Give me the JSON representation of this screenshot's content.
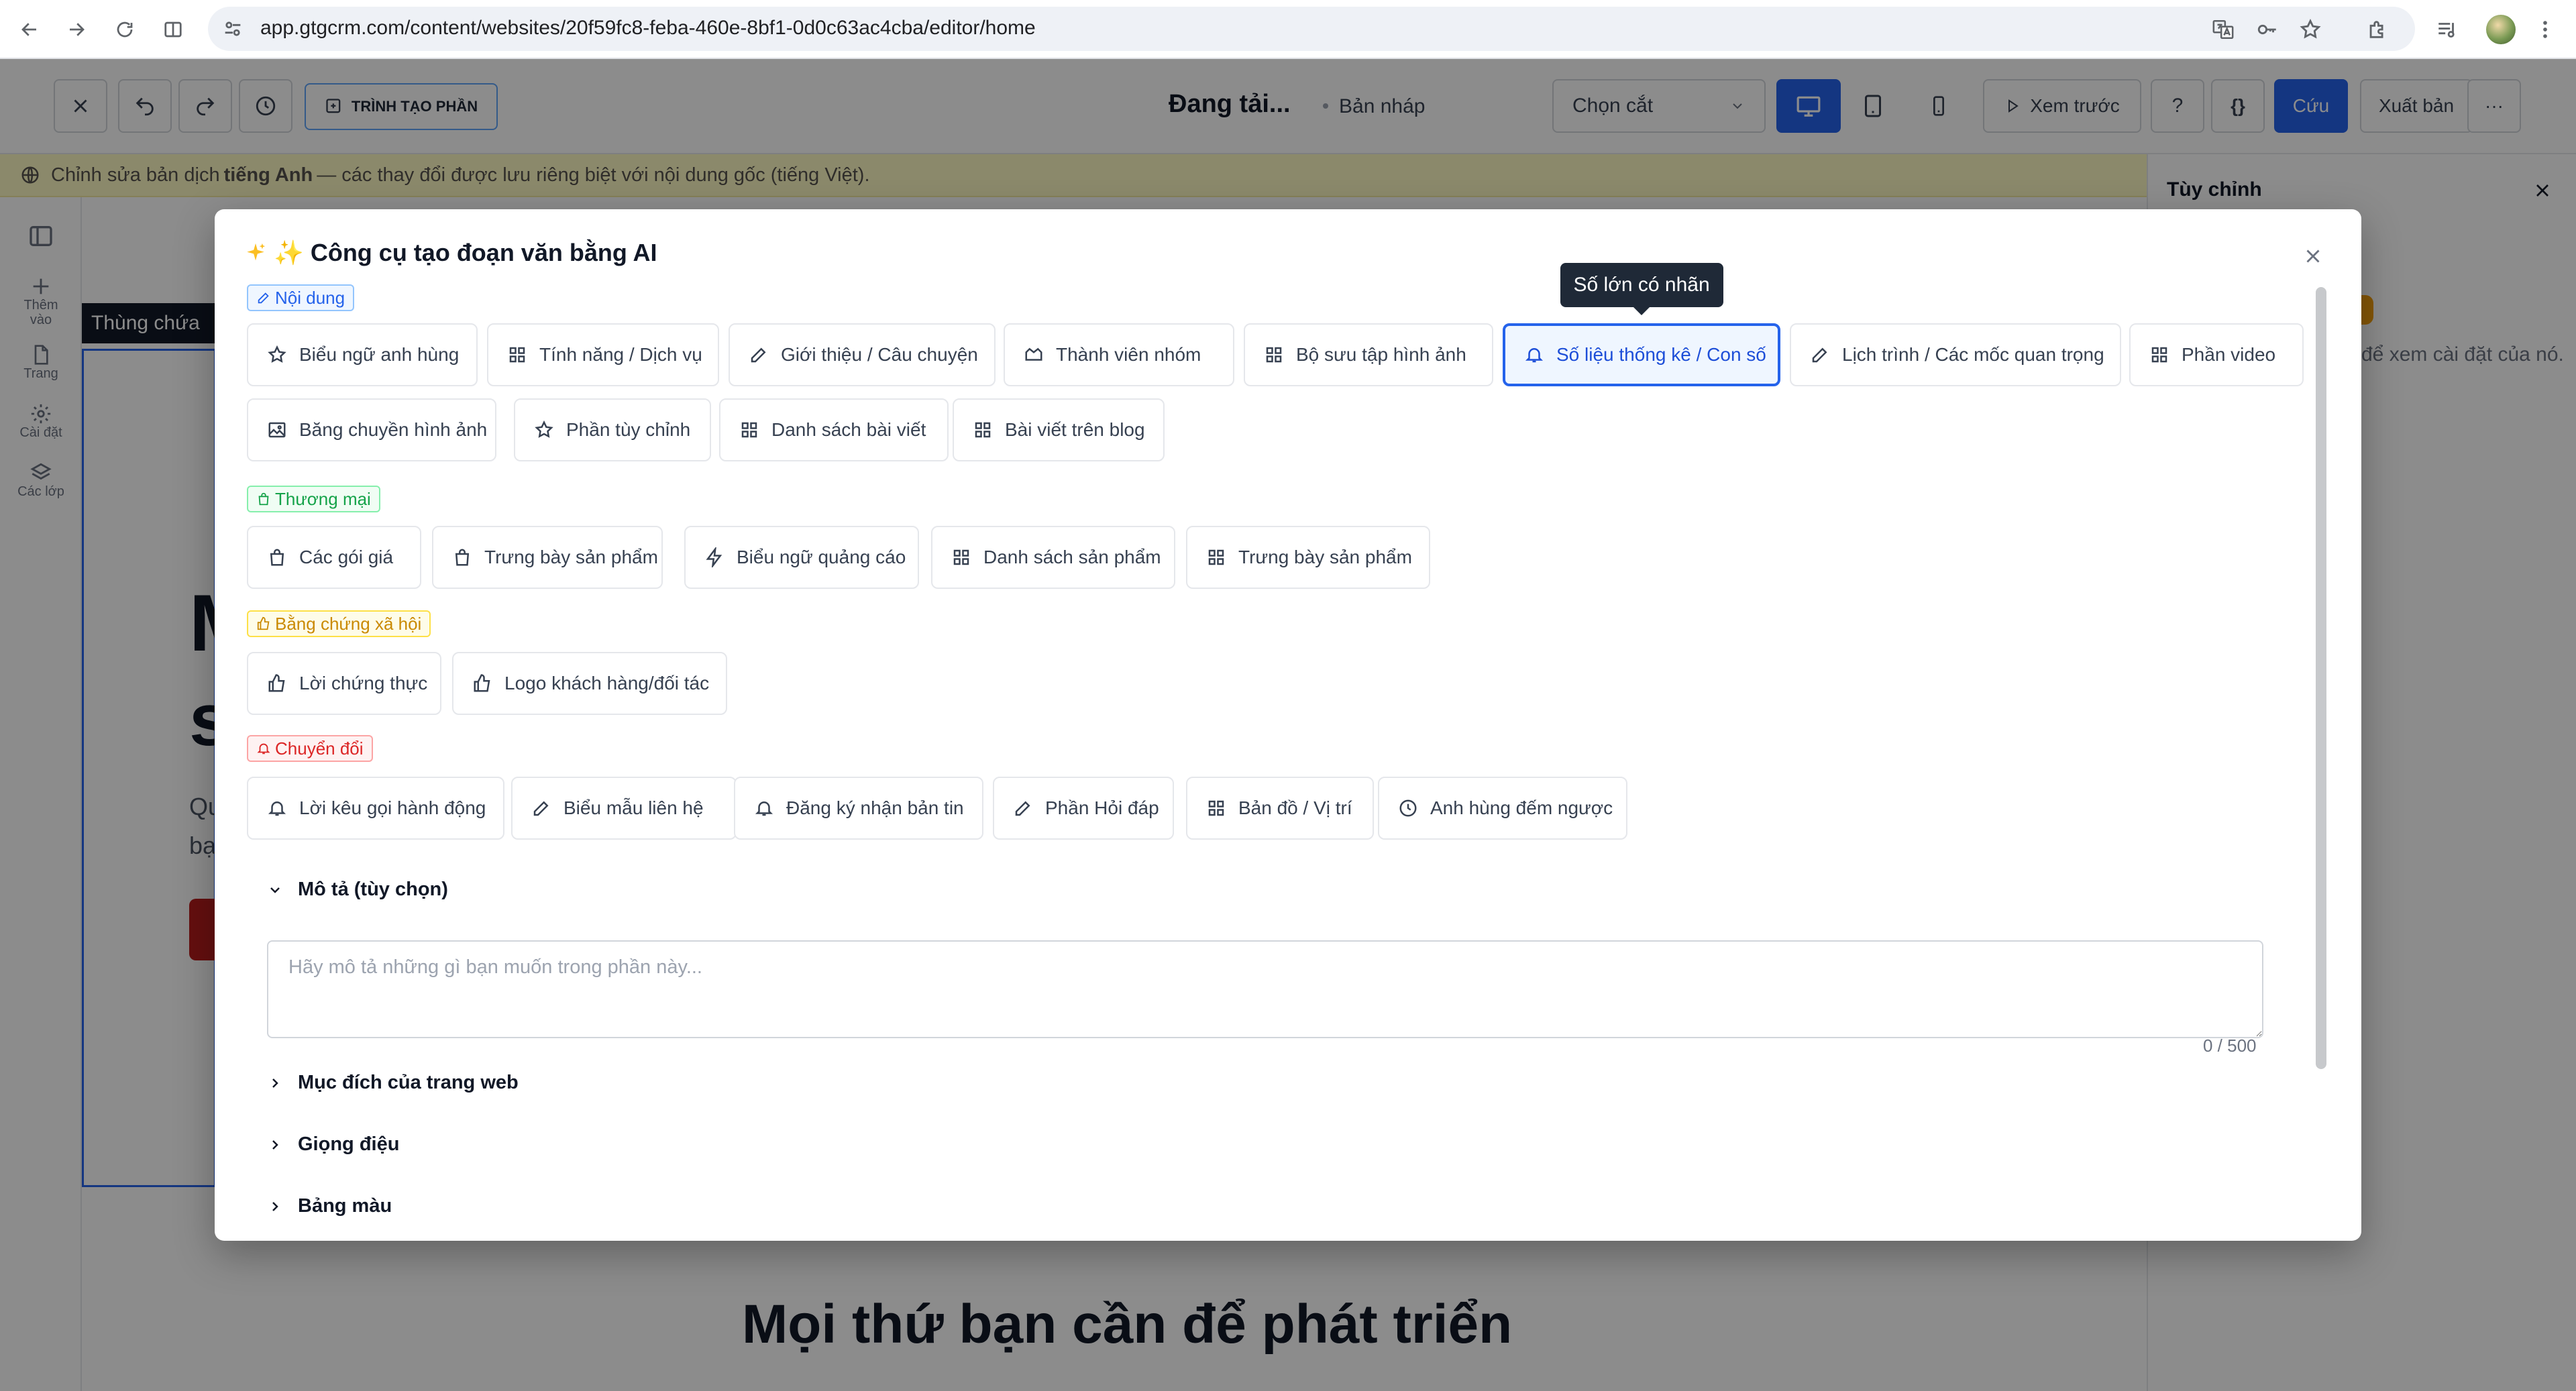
{
  "browser": {
    "url": "app.gtgcrm.com/content/websites/20f59fc8-feba-460e-8bf1-0d0c63ac4cba/editor/home"
  },
  "editor": {
    "creator_label": "TRÌNH TẠO PHẦN",
    "page_status": "Đang tải...",
    "draft_label": "Bản nháp",
    "breakpoint_select": "Chọn cắt",
    "preview_label": "Xem trước",
    "help_label": "?",
    "code_label": "{}",
    "save_label": "Cứu",
    "publish_label": "Xuất bản",
    "more_label": "···",
    "translation_banner_prefix": "Chỉnh sửa bản dịch ",
    "translation_banner_lang": "tiếng Anh",
    "translation_banner_suffix": " — các thay đổi được lưu riêng biệt với nội dung gốc (tiếng Việt).",
    "rail": [
      {
        "label": "Thêm vào"
      },
      {
        "label": "Trang"
      },
      {
        "label": "Cài đặt"
      },
      {
        "label": "Các lớp"
      }
    ],
    "container_tag": "Thùng chứa",
    "bg_text_1": "M",
    "bg_text_2": "s",
    "bg_text_3": "Qu",
    "bg_text_4": "bạ",
    "bottom_heading": "Mọi thứ bạn cần để phát triển",
    "right_panel_title": "Tùy chỉnh",
    "right_panel_hint": "để xem cài đặt của nó."
  },
  "modal": {
    "title": "✨ Công cụ tạo đoạn văn bằng AI",
    "tooltip": "Số lớn có nhãn",
    "categories": {
      "content": {
        "label": "Nội dung",
        "chips": [
          "Biểu ngữ anh hùng",
          "Tính năng / Dịch vụ",
          "Giới thiệu / Câu chuyện",
          "Thành viên nhóm",
          "Bộ sưu tập hình ảnh",
          "Số liệu thống kê / Con số",
          "Lịch trình / Các mốc quan trọng",
          "Phần video",
          "Băng chuyền hình ảnh",
          "Phần tùy chỉnh",
          "Danh sách bài viết",
          "Bài viết trên blog"
        ]
      },
      "commerce": {
        "label": "Thương mại",
        "chips": [
          "Các gói giá",
          "Trưng bày sản phẩm",
          "Biểu ngữ quảng cáo",
          "Danh sách sản phẩm",
          "Trưng bày sản phẩm"
        ]
      },
      "social": {
        "label": "Bằng chứng xã hội",
        "chips": [
          "Lời chứng thực",
          "Logo khách hàng/đối tác"
        ]
      },
      "conversion": {
        "label": "Chuyển đổi",
        "chips": [
          "Lời kêu gọi hành động",
          "Biểu mẫu liên hệ",
          "Đăng ký nhận bản tin",
          "Phần Hỏi đáp",
          "Bản đồ / Vị trí",
          "Anh hùng đếm ngược"
        ]
      }
    },
    "description": {
      "label": "Mô tả (tùy chọn)",
      "placeholder": "Hãy mô tả những gì bạn muốn trong phần này...",
      "counter": "0 / 500"
    },
    "sections": [
      "Mục đích của trang web",
      "Giọng điệu",
      "Bảng màu"
    ]
  },
  "colors": {
    "accent": "#2563eb",
    "content_tag": "#2563eb",
    "commerce_tag": "#16a34a",
    "social_tag": "#ca8a04",
    "conversion_tag": "#dc2626"
  }
}
